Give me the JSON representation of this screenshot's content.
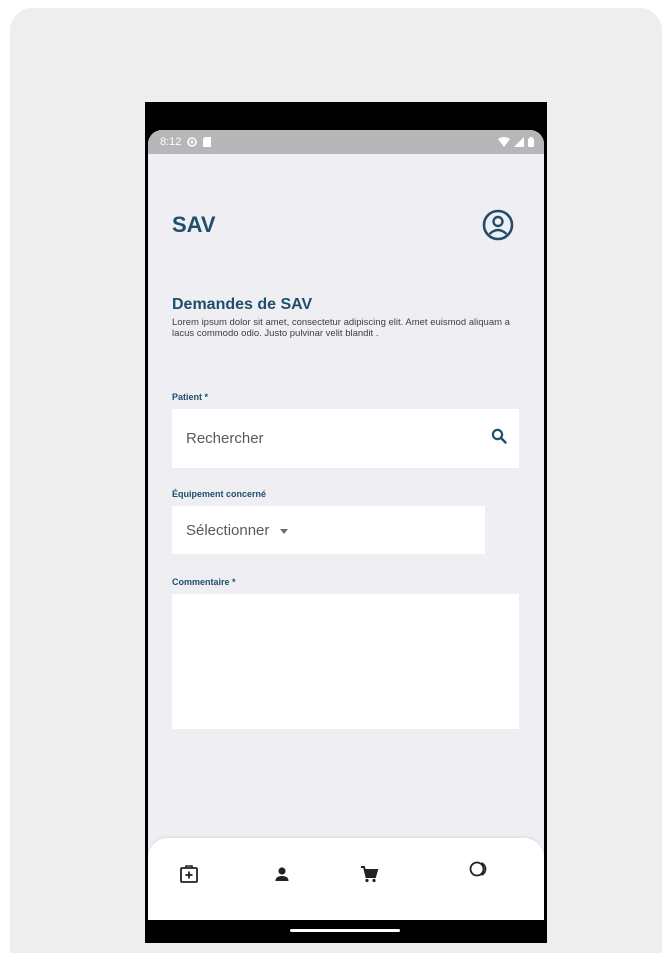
{
  "status_bar": {
    "time": "8:12"
  },
  "app": {
    "title": "SAV"
  },
  "section": {
    "title": "Demandes de SAV",
    "description": "Lorem ipsum dolor sit amet, consectetur adipiscing elit. Amet euismod aliquam a lacus commodo odio. Justo pulvinar velit blandit ."
  },
  "form": {
    "patient_label": "Patient *",
    "patient_placeholder": "Rechercher",
    "equipment_label": "Équipement concerné",
    "equipment_value": "Sélectionner",
    "comment_label": "Commentaire *"
  },
  "nav": {
    "items": [
      "medical-bag-icon",
      "person-icon",
      "cart-icon",
      "coins-icon"
    ]
  },
  "colors": {
    "primary": "#1f4e6b",
    "background": "#efeff3",
    "surface": "#ffffff"
  }
}
